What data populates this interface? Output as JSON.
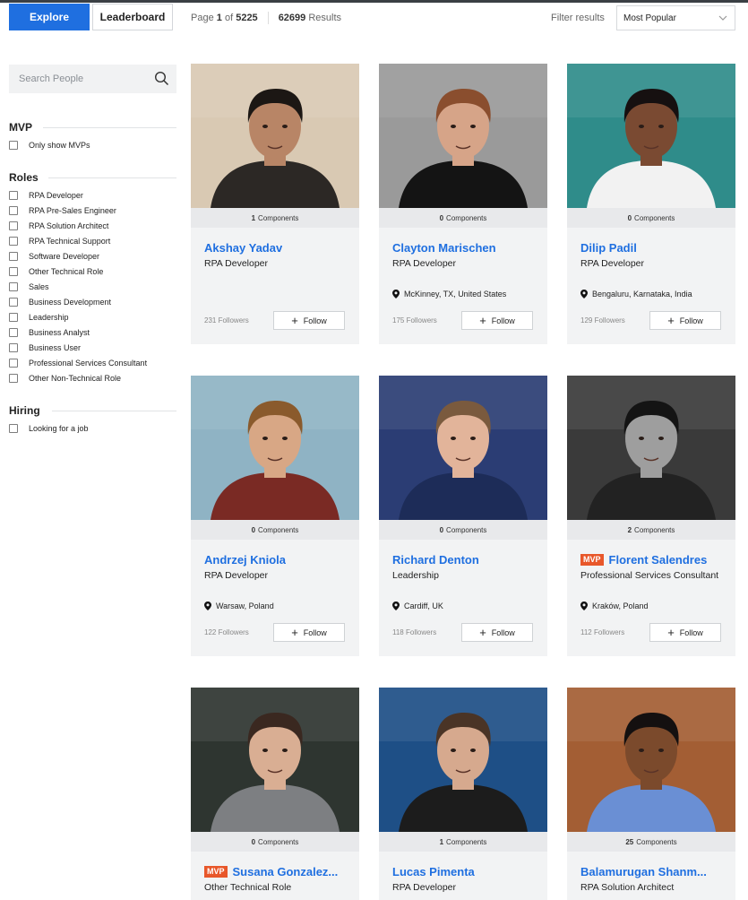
{
  "header": {
    "explore_label": "Explore",
    "leaderboard_label": "Leaderboard",
    "page_prefix": "Page",
    "page_current": "1",
    "page_of": "of",
    "page_total": "5225",
    "results_count": "62699",
    "results_label": "Results",
    "filter_label": "Filter results",
    "sort_value": "Most Popular"
  },
  "sidebar": {
    "search_placeholder": "Search People",
    "mvp": {
      "title": "MVP",
      "options": [
        "Only show MVPs"
      ]
    },
    "roles": {
      "title": "Roles",
      "options": [
        "RPA Developer",
        "RPA Pre-Sales Engineer",
        "RPA Solution Architect",
        "RPA Technical Support",
        "Software Developer",
        "Other Technical Role",
        "Sales",
        "Business Development",
        "Leadership",
        "Business Analyst",
        "Business User",
        "Professional Services Consultant",
        "Other Non-Technical Role"
      ]
    },
    "hiring": {
      "title": "Hiring",
      "options": [
        "Looking for a job"
      ]
    }
  },
  "people": [
    {
      "name": "Akshay Yadav",
      "role": "RPA Developer",
      "location": "",
      "components": "1",
      "components_label": "Components",
      "followers": "231 Followers",
      "follow_label": "Follow",
      "mvp": false,
      "photo": {
        "bg": "#d9c9b3",
        "skin": "#b88566",
        "hair": "#1c1714",
        "shirt": "#2c2825"
      }
    },
    {
      "name": "Clayton Marischen",
      "role": "RPA Developer",
      "location": "McKinney, TX, United States",
      "components": "0",
      "components_label": "Components",
      "followers": "175 Followers",
      "follow_label": "Follow",
      "mvp": false,
      "photo": {
        "bg": "#9a9a9a",
        "skin": "#d6a488",
        "hair": "#8a4e2e",
        "shirt": "#141414"
      }
    },
    {
      "name": "Dilip Padil",
      "role": "RPA Developer",
      "location": "Bengaluru, Karnataka, India",
      "components": "0",
      "components_label": "Components",
      "followers": "129 Followers",
      "follow_label": "Follow",
      "mvp": false,
      "photo": {
        "bg": "#2f8c8a",
        "skin": "#7a4a32",
        "hair": "#161010",
        "shirt": "#f2f2f2"
      }
    },
    {
      "name": "Andrzej Kniola",
      "role": "RPA Developer",
      "location": "Warsaw, Poland",
      "components": "0",
      "components_label": "Components",
      "followers": "122 Followers",
      "follow_label": "Follow",
      "mvp": false,
      "photo": {
        "bg": "#8fb3c4",
        "skin": "#d8a785",
        "hair": "#8a5a2c",
        "shirt": "#7a2a24"
      }
    },
    {
      "name": "Richard Denton",
      "role": "Leadership",
      "location": "Cardiff, UK",
      "components": "0",
      "components_label": "Components",
      "followers": "118 Followers",
      "follow_label": "Follow",
      "mvp": false,
      "photo": {
        "bg": "#2b3d74",
        "skin": "#e2b49a",
        "hair": "#7a5a3e",
        "shirt": "#1d2c58"
      }
    },
    {
      "name": "Florent Salendres",
      "role": "Professional Services Consultant",
      "location": "Kraków, Poland",
      "components": "2",
      "components_label": "Components",
      "followers": "112 Followers",
      "follow_label": "Follow",
      "mvp": true,
      "mvp_label": "MVP",
      "photo": {
        "bg": "#3a3a3a",
        "skin": "#9e9e9e",
        "hair": "#141414",
        "shirt": "#222222"
      }
    },
    {
      "name": "Susana Gonzalez...",
      "role": "Other Technical Role",
      "location": "",
      "components": "0",
      "components_label": "Components",
      "followers": "",
      "follow_label": "Follow",
      "mvp": true,
      "mvp_label": "MVP",
      "photo": {
        "bg": "#2e3530",
        "skin": "#d9ae93",
        "hair": "#3a2820",
        "shirt": "#7d7f82"
      }
    },
    {
      "name": "Lucas Pimenta",
      "role": "RPA Developer",
      "location": "",
      "components": "1",
      "components_label": "Components",
      "followers": "",
      "follow_label": "Follow",
      "mvp": false,
      "photo": {
        "bg": "#1e4f86",
        "skin": "#d6a98e",
        "hair": "#4a3426",
        "shirt": "#1c1c1c"
      }
    },
    {
      "name": "Balamurugan Shanm...",
      "role": "RPA Solution Architect",
      "location": "",
      "components": "25",
      "components_label": "Components",
      "followers": "",
      "follow_label": "Follow",
      "mvp": false,
      "photo": {
        "bg": "#a35e34",
        "skin": "#7b4a2c",
        "hair": "#141010",
        "shirt": "#6a8fd4"
      }
    }
  ]
}
